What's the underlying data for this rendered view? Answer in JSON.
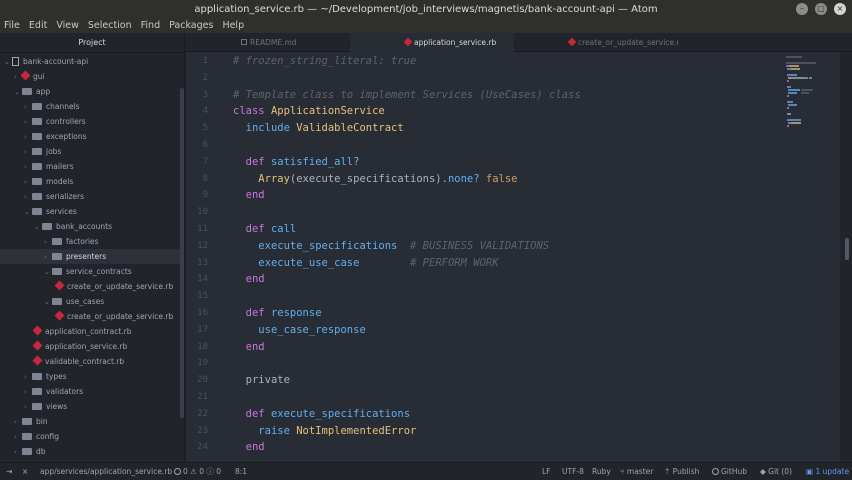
{
  "window": {
    "title": "application_service.rb — ~/Development/job_interviews/magnetis/bank-account-api — Atom"
  },
  "menu": [
    "File",
    "Edit",
    "View",
    "Selection",
    "Find",
    "Packages",
    "Help"
  ],
  "tree": {
    "header": "Project",
    "items": [
      {
        "label": "bank-account-api",
        "type": "repo",
        "expanded": true
      },
      {
        "label": "gui",
        "type": "ruby-folder",
        "expanded": false
      },
      {
        "label": "app",
        "type": "folder",
        "expanded": true
      },
      {
        "label": "channels",
        "type": "folder",
        "expanded": false
      },
      {
        "label": "controllers",
        "type": "folder",
        "expanded": false
      },
      {
        "label": "exceptions",
        "type": "folder",
        "expanded": false
      },
      {
        "label": "jobs",
        "type": "folder",
        "expanded": false
      },
      {
        "label": "mailers",
        "type": "folder",
        "expanded": false
      },
      {
        "label": "models",
        "type": "folder",
        "expanded": false
      },
      {
        "label": "serializers",
        "type": "folder",
        "expanded": false
      },
      {
        "label": "services",
        "type": "folder",
        "expanded": true
      },
      {
        "label": "bank_accounts",
        "type": "folder",
        "expanded": true
      },
      {
        "label": "factories",
        "type": "folder",
        "expanded": false
      },
      {
        "label": "presenters",
        "type": "folder",
        "expanded": false,
        "selected": true
      },
      {
        "label": "service_contracts",
        "type": "folder",
        "expanded": true
      },
      {
        "label": "create_or_update_service.rb",
        "type": "file"
      },
      {
        "label": "use_cases",
        "type": "folder",
        "expanded": true
      },
      {
        "label": "create_or_update_service.rb",
        "type": "file"
      },
      {
        "label": "application_contract.rb",
        "type": "file"
      },
      {
        "label": "application_service.rb",
        "type": "file"
      },
      {
        "label": "validable_contract.rb",
        "type": "file"
      },
      {
        "label": "types",
        "type": "folder",
        "expanded": false
      },
      {
        "label": "validators",
        "type": "folder",
        "expanded": false
      },
      {
        "label": "views",
        "type": "folder",
        "expanded": false
      },
      {
        "label": "bin",
        "type": "folder",
        "expanded": false
      },
      {
        "label": "config",
        "type": "folder",
        "expanded": false
      },
      {
        "label": "db",
        "type": "folder",
        "expanded": false
      }
    ]
  },
  "tabs": [
    {
      "label": "README.md",
      "icon": "txt",
      "active": false
    },
    {
      "label": "application_service.rb",
      "icon": "rb",
      "active": true
    },
    {
      "label": "create_or_update_service.rb",
      "icon": "rb",
      "active": false
    }
  ],
  "editor": {
    "lines": [
      {
        "n": "1",
        "tokens": [
          [
            "c-cm",
            "# frozen_string_literal: true"
          ]
        ]
      },
      {
        "n": "2",
        "tokens": []
      },
      {
        "n": "3",
        "tokens": [
          [
            "c-cm",
            "# Template class to implement Services (UseCases) class"
          ]
        ]
      },
      {
        "n": "4",
        "tokens": [
          [
            "c-kw",
            "class "
          ],
          [
            "c-cls",
            "ApplicationService"
          ]
        ]
      },
      {
        "n": "5",
        "tokens": [
          [
            "c-txt",
            "  "
          ],
          [
            "c-fn",
            "include "
          ],
          [
            "c-cls",
            "ValidableContract"
          ]
        ]
      },
      {
        "n": "6",
        "tokens": []
      },
      {
        "n": "7",
        "tokens": [
          [
            "c-txt",
            "  "
          ],
          [
            "c-kw",
            "def "
          ],
          [
            "c-fn",
            "satisfied_all?"
          ]
        ]
      },
      {
        "n": "8",
        "tokens": [
          [
            "c-txt",
            "    "
          ],
          [
            "c-cls",
            "Array"
          ],
          [
            "c-txt",
            "(execute_specifications)."
          ],
          [
            "c-fn",
            "none?"
          ],
          [
            "c-txt",
            " "
          ],
          [
            "c-con",
            "false"
          ]
        ]
      },
      {
        "n": "9",
        "tokens": [
          [
            "c-txt",
            "  "
          ],
          [
            "c-kw",
            "end"
          ]
        ]
      },
      {
        "n": "10",
        "tokens": []
      },
      {
        "n": "11",
        "tokens": [
          [
            "c-txt",
            "  "
          ],
          [
            "c-kw",
            "def "
          ],
          [
            "c-fn",
            "call"
          ]
        ]
      },
      {
        "n": "12",
        "tokens": [
          [
            "c-txt",
            "    "
          ],
          [
            "c-fn",
            "execute_specifications"
          ],
          [
            "c-txt",
            "  "
          ],
          [
            "c-cm",
            "# BUSINESS VALIDATIONS"
          ]
        ]
      },
      {
        "n": "13",
        "tokens": [
          [
            "c-txt",
            "    "
          ],
          [
            "c-fn",
            "execute_use_case"
          ],
          [
            "c-txt",
            "        "
          ],
          [
            "c-cm",
            "# PERFORM WORK"
          ]
        ]
      },
      {
        "n": "14",
        "tokens": [
          [
            "c-txt",
            "  "
          ],
          [
            "c-kw",
            "end"
          ]
        ]
      },
      {
        "n": "15",
        "tokens": []
      },
      {
        "n": "16",
        "tokens": [
          [
            "c-txt",
            "  "
          ],
          [
            "c-kw",
            "def "
          ],
          [
            "c-fn",
            "response"
          ]
        ]
      },
      {
        "n": "17",
        "tokens": [
          [
            "c-txt",
            "    "
          ],
          [
            "c-fn",
            "use_case_response"
          ]
        ]
      },
      {
        "n": "18",
        "tokens": [
          [
            "c-txt",
            "  "
          ],
          [
            "c-kw",
            "end"
          ]
        ]
      },
      {
        "n": "19",
        "tokens": []
      },
      {
        "n": "20",
        "tokens": [
          [
            "c-txt",
            "  "
          ],
          [
            "c-txt",
            "private"
          ]
        ]
      },
      {
        "n": "21",
        "tokens": []
      },
      {
        "n": "22",
        "tokens": [
          [
            "c-txt",
            "  "
          ],
          [
            "c-kw",
            "def "
          ],
          [
            "c-fn",
            "execute_specifications"
          ]
        ]
      },
      {
        "n": "23",
        "tokens": [
          [
            "c-txt",
            "    "
          ],
          [
            "c-fn",
            "raise "
          ],
          [
            "c-cls",
            "NotImplementedError"
          ]
        ]
      },
      {
        "n": "24",
        "tokens": [
          [
            "c-txt",
            "  "
          ],
          [
            "c-kw",
            "end"
          ]
        ]
      }
    ]
  },
  "status": {
    "file_path": "app/services/application_service.rb",
    "diagnostics": "0 ⚠ 0 ⓘ 0",
    "cursor": "8:1",
    "line_ending": "LF",
    "encoding": "UTF-8",
    "grammar": "Ruby",
    "branch": "master",
    "publish": "Publish",
    "github": "GitHub",
    "git": "Git (0)",
    "update": "1 update"
  },
  "colors": {
    "background": "#282c34",
    "panel": "#21252b",
    "keyword": "#c678dd",
    "class": "#e5c07b",
    "function": "#61afef",
    "comment": "#5c6370",
    "accent": "#6494ed"
  }
}
